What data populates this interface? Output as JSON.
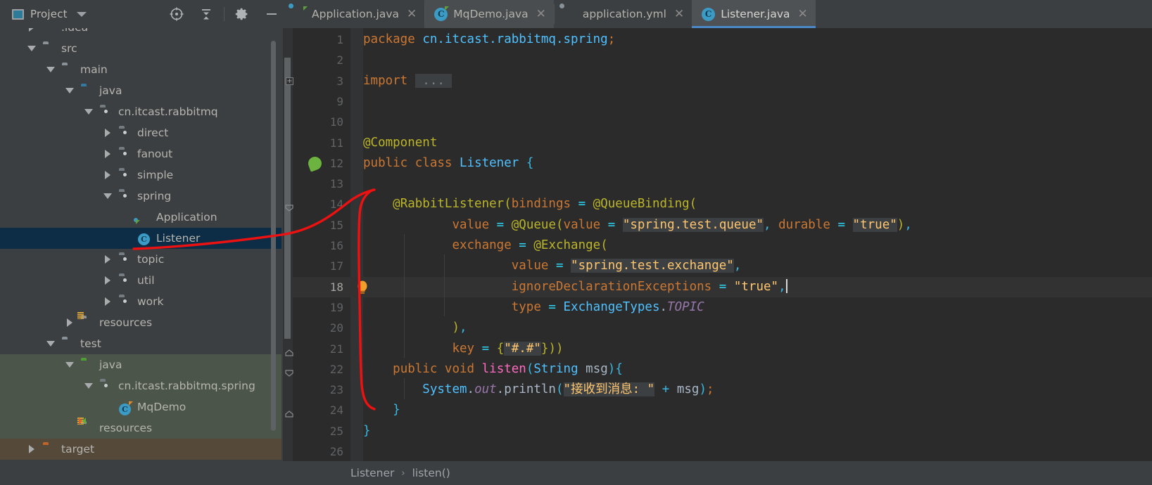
{
  "window": {
    "project_panel_title": "Project",
    "toolbar_icons": [
      "locate-crosshair-icon",
      "collapse-all-icon",
      "gear-icon",
      "minimize-icon"
    ]
  },
  "tabs": [
    {
      "label": "Application.java",
      "icon": "spring-boot-class-icon",
      "active": false,
      "closable": true
    },
    {
      "label": "MqDemo.java",
      "icon": "java-test-class-icon",
      "active": false,
      "closable": true
    },
    {
      "label": "application.yml",
      "icon": "spring-yaml-icon",
      "active": false,
      "closable": true
    },
    {
      "label": "Listener.java",
      "icon": "java-class-icon",
      "active": true,
      "closable": true
    }
  ],
  "tree": [
    {
      "label": ".idea",
      "depth": 1,
      "arrow": "right",
      "icon": "folder",
      "tint": "none"
    },
    {
      "label": "src",
      "depth": 1,
      "arrow": "down",
      "icon": "folder",
      "tint": "none"
    },
    {
      "label": "main",
      "depth": 2,
      "arrow": "down",
      "icon": "folder",
      "tint": "none"
    },
    {
      "label": "java",
      "depth": 3,
      "arrow": "down",
      "icon": "folder-blue",
      "tint": "none"
    },
    {
      "label": "cn.itcast.rabbitmq",
      "depth": 4,
      "arrow": "down",
      "icon": "package",
      "tint": "none"
    },
    {
      "label": "direct",
      "depth": 5,
      "arrow": "right",
      "icon": "package",
      "tint": "none"
    },
    {
      "label": "fanout",
      "depth": 5,
      "arrow": "right",
      "icon": "package",
      "tint": "none"
    },
    {
      "label": "simple",
      "depth": 5,
      "arrow": "right",
      "icon": "package",
      "tint": "none"
    },
    {
      "label": "spring",
      "depth": 5,
      "arrow": "down",
      "icon": "package",
      "tint": "none"
    },
    {
      "label": "Application",
      "depth": 6,
      "arrow": "none",
      "icon": "spring-boot-class-icon",
      "tint": "none"
    },
    {
      "label": "Listener",
      "depth": 6,
      "arrow": "none",
      "icon": "java-class-icon",
      "tint": "selected"
    },
    {
      "label": "topic",
      "depth": 5,
      "arrow": "right",
      "icon": "package",
      "tint": "none"
    },
    {
      "label": "util",
      "depth": 5,
      "arrow": "right",
      "icon": "package",
      "tint": "none"
    },
    {
      "label": "work",
      "depth": 5,
      "arrow": "right",
      "icon": "package",
      "tint": "none"
    },
    {
      "label": "resources",
      "depth": 3,
      "arrow": "right",
      "icon": "resources-folder",
      "tint": "none"
    },
    {
      "label": "test",
      "depth": 2,
      "arrow": "down",
      "icon": "folder",
      "tint": "none"
    },
    {
      "label": "java",
      "depth": 3,
      "arrow": "down",
      "icon": "folder-green",
      "tint": "green"
    },
    {
      "label": "cn.itcast.rabbitmq.spring",
      "depth": 4,
      "arrow": "down",
      "icon": "package",
      "tint": "green"
    },
    {
      "label": "MqDemo",
      "depth": 5,
      "arrow": "none",
      "icon": "java-test-class-icon",
      "tint": "green"
    },
    {
      "label": "resources",
      "depth": 3,
      "arrow": "none",
      "icon": "test-resources-folder",
      "tint": "green"
    },
    {
      "label": "target",
      "depth": 1,
      "arrow": "right",
      "icon": "folder-orange",
      "tint": "brown"
    }
  ],
  "editor": {
    "line_numbers": [
      "1",
      "2",
      "3",
      "9",
      "10",
      "11",
      "12",
      "13",
      "14",
      "15",
      "16",
      "17",
      "18",
      "19",
      "20",
      "21",
      "22",
      "23",
      "24",
      "25",
      "26"
    ],
    "current_line": "18",
    "fold_collapsed_text": "...",
    "gutter_markers": [
      {
        "line": "3",
        "marker": "fold-expand-plus-icon"
      },
      {
        "line": "12",
        "marker": "spring-bean-icon"
      },
      {
        "line": "18",
        "marker": "intention-bulb-icon"
      },
      {
        "line": "21",
        "marker": "fold-end-icon"
      },
      {
        "line": "22",
        "marker": "fold-start-icon"
      },
      {
        "line": "24",
        "marker": "fold-end-icon"
      }
    ],
    "code_lines": [
      "package cn.itcast.rabbitmq.spring;",
      "",
      "import ...",
      "",
      "",
      "@Component",
      "public class Listener {",
      "",
      "    @RabbitListener(bindings = @QueueBinding(",
      "            value = @Queue(value = \"spring.test.queue\", durable = \"true\"),",
      "            exchange = @Exchange(",
      "                    value = \"spring.test.exchange\",",
      "                    ignoreDeclarationExceptions = \"true\",",
      "                    type = ExchangeTypes.TOPIC",
      "            ),",
      "            key = {\"#.#\"}))",
      "    public void listen(String msg){",
      "        System.out.println(\"接收到消息: \" + msg);",
      "    }",
      "}",
      ""
    ],
    "strings": {
      "queue_name": "spring.test.queue",
      "durable_value": "true",
      "exchange_name": "spring.test.exchange",
      "ignore_declaration_value": "true",
      "exchange_type": "ExchangeTypes.TOPIC",
      "routing_key": "#.#",
      "println_text": "接收到消息: "
    }
  },
  "breadcrumb": {
    "items": [
      "Listener",
      "listen()"
    ],
    "separator": "›"
  },
  "colors": {
    "accent_blue": "#4a88c7",
    "selection_blue": "#0d2c45",
    "editor_bg": "#2b2b2b",
    "panel_bg": "#3c3f41",
    "annotation_red": "#ee1111",
    "string_yellow": "#ffc66d",
    "keyword_orange": "#cc7832",
    "annotation_olive": "#bbb529"
  }
}
